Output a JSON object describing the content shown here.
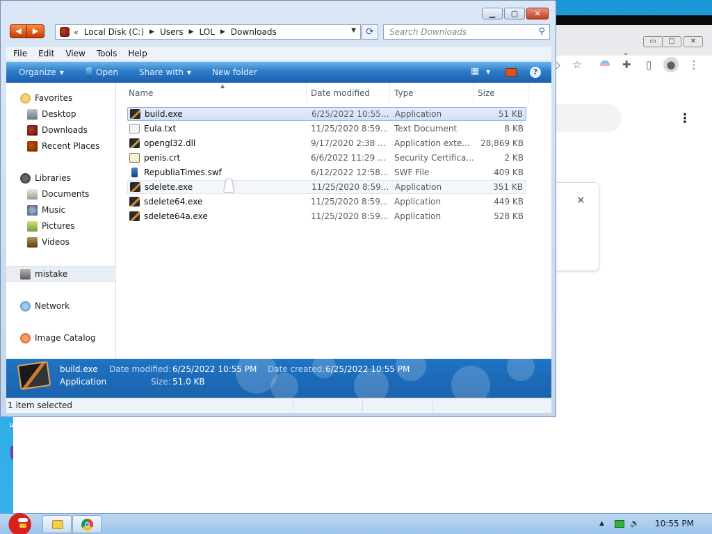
{
  "desktop": {
    "edge_text": "u"
  },
  "browser": {
    "controls": {
      "minimize": "▭",
      "maximize": "▢",
      "close": "✕"
    },
    "chevron": "⌄",
    "toolbar": {
      "bookmark": "◇",
      "star": "☆",
      "extensions": "✚",
      "sidepanel": "▯",
      "avatar": "●",
      "menu": "⋮"
    },
    "kebab": "⋮",
    "card_close": "✕"
  },
  "explorer": {
    "controls": {
      "minimize": "▁",
      "maximize": "▢",
      "close": "✕"
    },
    "nav": {
      "back": "◀",
      "forward": "▶"
    },
    "address": {
      "chevrons": "«",
      "crumbs": [
        "Local Disk (C:)",
        "Users",
        "LOL",
        "Downloads"
      ],
      "separator": "▶",
      "dropdown": "▼"
    },
    "refresh_glyph": "⟳",
    "search": {
      "placeholder": "Search Downloads",
      "icon": "⚲"
    },
    "menu": [
      "File",
      "Edit",
      "View",
      "Tools",
      "Help"
    ],
    "commands": {
      "organize": "Organize",
      "open": "Open",
      "share_with": "Share with",
      "new_folder": "New folder",
      "caret": "▼",
      "help": "?"
    },
    "navpane": {
      "favorites": "Favorites",
      "desktop": "Desktop",
      "downloads": "Downloads",
      "recent_places": "Recent Places",
      "libraries": "Libraries",
      "documents": "Documents",
      "music": "Music",
      "pictures": "Pictures",
      "videos": "Videos",
      "user": "mistake",
      "network": "Network",
      "image_catalog": "Image Catalog"
    },
    "columns": {
      "name": "Name",
      "date_modified": "Date modified",
      "type": "Type",
      "size": "Size",
      "sort_caret": "▲"
    },
    "files": [
      {
        "name": "build.exe",
        "date": "6/25/2022 10:55...",
        "type": "Application",
        "size": "51 KB"
      },
      {
        "name": "Eula.txt",
        "date": "11/25/2020 8:59...",
        "type": "Text Document",
        "size": "8 KB"
      },
      {
        "name": "opengl32.dll",
        "date": "9/17/2020 2:38 ...",
        "type": "Application exte...",
        "size": "28,869 KB"
      },
      {
        "name": "penis.crt",
        "date": "6/6/2022 11:29 ...",
        "type": "Security Certifica...",
        "size": "2 KB"
      },
      {
        "name": "RepubliaTimes.swf",
        "date": "6/12/2022 12:58...",
        "type": "SWF File",
        "size": "409 KB"
      },
      {
        "name": "sdelete.exe",
        "date": "11/25/2020 8:59...",
        "type": "Application",
        "size": "351 KB"
      },
      {
        "name": "sdelete64.exe",
        "date": "11/25/2020 8:59...",
        "type": "Application",
        "size": "449 KB"
      },
      {
        "name": "sdelete64a.exe",
        "date": "11/25/2020 8:59...",
        "type": "Application",
        "size": "528 KB"
      }
    ],
    "details": {
      "filename": "build.exe",
      "filetype": "Application",
      "modified_label": "Date modified:",
      "modified_value": "6/25/2022 10:55 PM",
      "created_label": "Date created:",
      "created_value": "6/25/2022 10:55 PM",
      "size_label": "Size:",
      "size_value": "51.0 KB"
    },
    "status": "1 item selected"
  },
  "taskbar": {
    "tray_up": "▲",
    "volume": "🔈",
    "clock": "10:55 PM"
  }
}
